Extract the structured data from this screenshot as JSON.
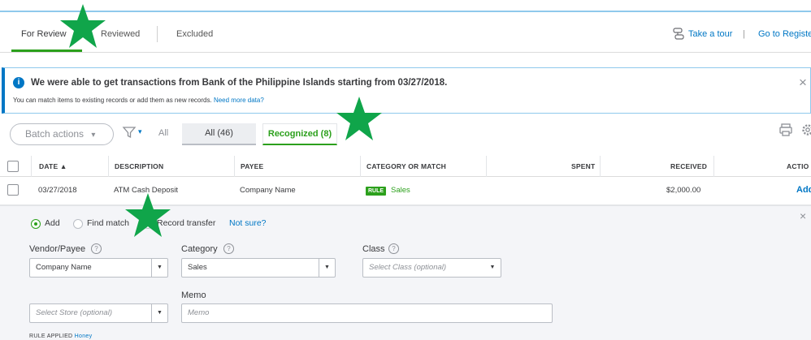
{
  "tabs": [
    {
      "label": "For Review",
      "active": true
    },
    {
      "label": "Reviewed",
      "active": false
    },
    {
      "label": "Excluded",
      "active": false
    }
  ],
  "top_links": {
    "tour": "Take a tour",
    "separator": "|",
    "register": "Go to Registe"
  },
  "banner": {
    "title": "We were able to get transactions from Bank of the Philippine Islands starting from 03/27/2018.",
    "subtitle": "You can match items to existing records or add them as new records.",
    "link": "Need more data?",
    "close": "×",
    "info_icon": "i"
  },
  "toolbar": {
    "batch_actions": "Batch actions",
    "batch_caret": "▾",
    "filter_caret": "▾",
    "filter_all": "All",
    "tab_all": "All (46)",
    "tab_recognized": "Recognized (8)"
  },
  "table": {
    "headers": {
      "date": "DATE ▲",
      "description": "DESCRIPTION",
      "payee": "PAYEE",
      "category": "CATEGORY OR MATCH",
      "spent": "SPENT",
      "received": "RECEIVED",
      "action": "ACTIO"
    },
    "row": {
      "date": "03/27/2018",
      "description": "ATM Cash Deposit",
      "payee": "Company Name",
      "rule_badge": "RULE",
      "category": "Sales",
      "spent": "",
      "received": "$2,000.00",
      "action": "Add"
    }
  },
  "panel": {
    "radios": [
      {
        "label": "Add",
        "selected": true
      },
      {
        "label": "Find match",
        "selected": false
      },
      {
        "label": "Record transfer",
        "selected": false
      }
    ],
    "not_sure": "Not sure?",
    "close": "×",
    "vendor_label": "Vendor/Payee",
    "vendor_value": "Company Name",
    "category_label": "Category",
    "category_value": "Sales",
    "class_label": "Class",
    "class_placeholder": "Select Class (optional)",
    "memo_label": "Memo",
    "memo_placeholder": "Memo",
    "store_placeholder": "Select Store (optional)",
    "help": "?",
    "caret": "▼",
    "rule_applied": "RULE APPLIED",
    "rule_applied_link": "Honey"
  },
  "colors": {
    "accent_green": "#2ca01c",
    "link_blue": "#0077c5",
    "star_green": "#10a54a"
  }
}
